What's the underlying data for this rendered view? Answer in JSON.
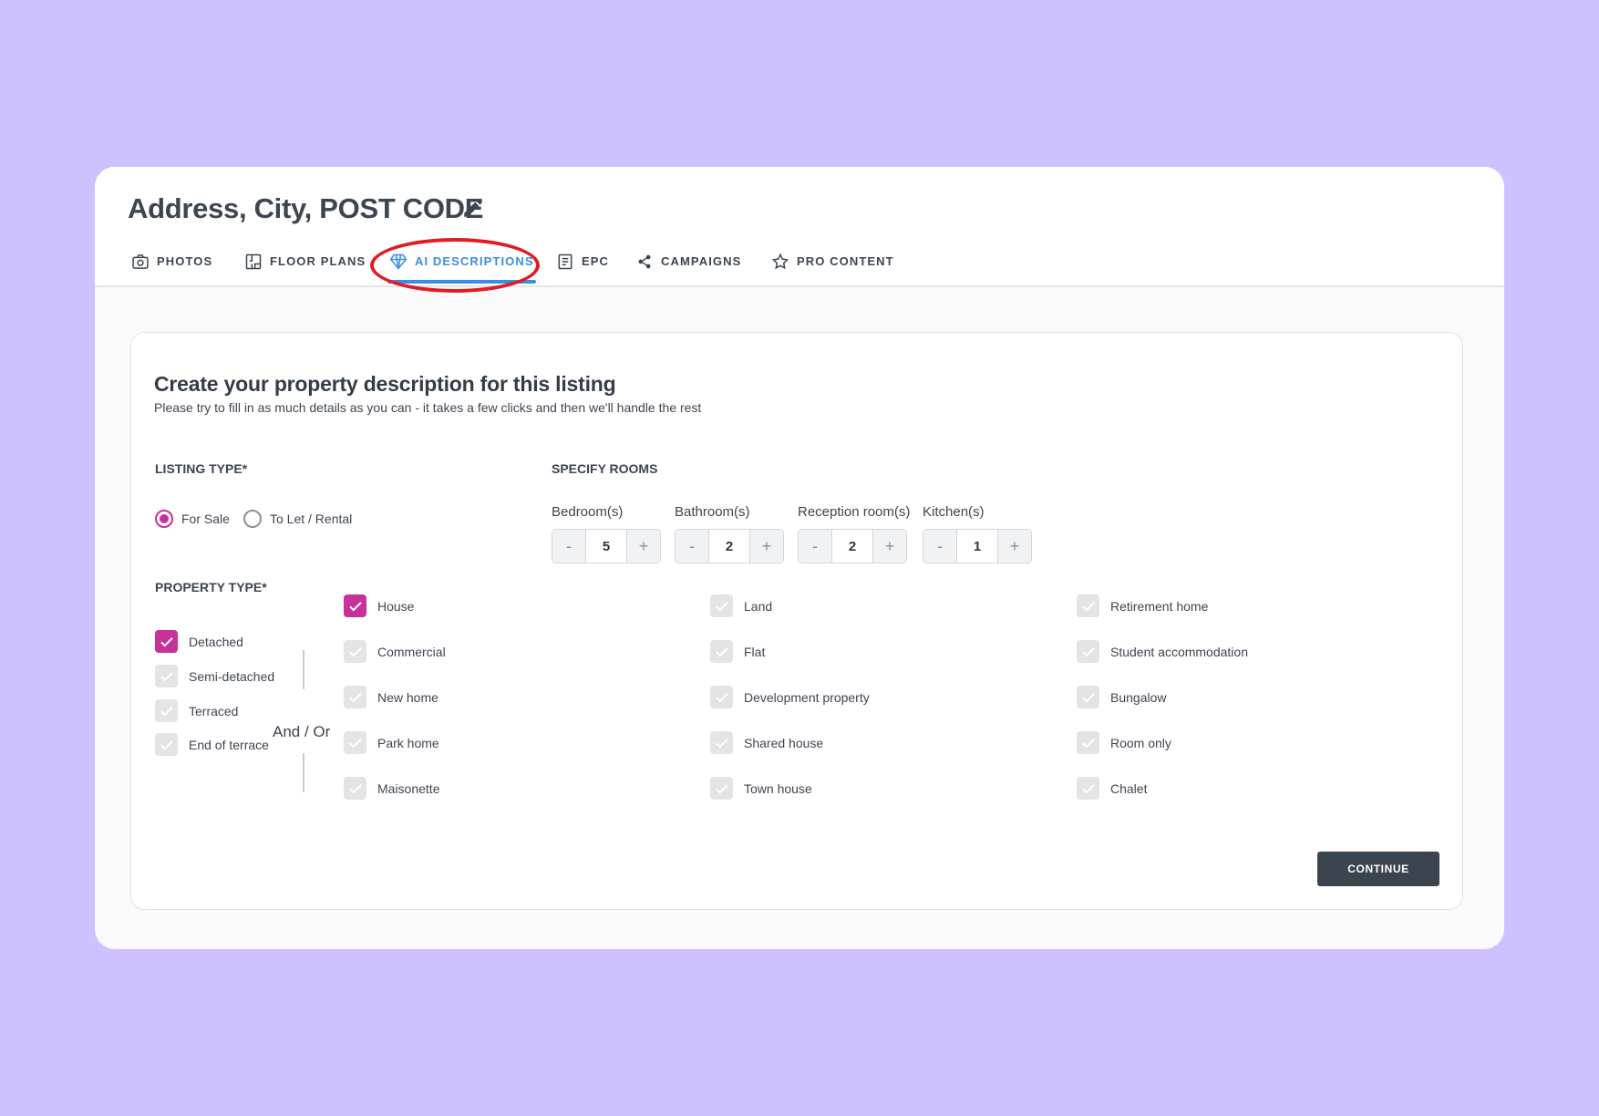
{
  "header": {
    "title": "Address, City, POST CODE",
    "edit_icon": "pencil-icon",
    "tabs": [
      {
        "label": "PHOTOS",
        "icon": "camera-icon"
      },
      {
        "label": "FLOOR PLANS",
        "icon": "floor-plan-icon"
      },
      {
        "label": "AI DESCRIPTIONS",
        "icon": "diamond-icon",
        "active": true
      },
      {
        "label": "EPC",
        "icon": "document-icon"
      },
      {
        "label": "CAMPAIGNS",
        "icon": "share-icon"
      },
      {
        "label": "PRO CONTENT",
        "icon": "star-icon"
      }
    ]
  },
  "form": {
    "title": "Create your property description for this listing",
    "subtitle": "Please try to fill in as much details as you can - it takes a few clicks and then we'll handle the rest",
    "listing_type": {
      "label": "LISTING TYPE*",
      "options": [
        {
          "label": "For Sale",
          "selected": true
        },
        {
          "label": "To Let / Rental",
          "selected": false
        }
      ]
    },
    "rooms": {
      "label": "SPECIFY ROOMS",
      "minus": "-",
      "plus": "+",
      "items": [
        {
          "label": "Bedroom(s)",
          "value": "5"
        },
        {
          "label": "Bathroom(s)",
          "value": "2"
        },
        {
          "label": "Reception room(s)",
          "value": "2"
        },
        {
          "label": "Kitchen(s)",
          "value": "1"
        }
      ]
    },
    "property_type": {
      "label": "PROPERTY TYPE*",
      "styles": [
        {
          "label": "Detached",
          "checked": true
        },
        {
          "label": "Semi-detached",
          "checked": false
        },
        {
          "label": "Terraced",
          "checked": false
        },
        {
          "label": "End of terrace",
          "checked": false
        }
      ],
      "and_or": "And / Or",
      "types": [
        {
          "label": "House",
          "checked": true
        },
        {
          "label": "Commercial",
          "checked": false
        },
        {
          "label": "New home",
          "checked": false
        },
        {
          "label": "Park home",
          "checked": false
        },
        {
          "label": "Maisonette",
          "checked": false
        },
        {
          "label": "Land",
          "checked": false
        },
        {
          "label": "Flat",
          "checked": false
        },
        {
          "label": "Development property",
          "checked": false
        },
        {
          "label": "Shared house",
          "checked": false
        },
        {
          "label": "Town house",
          "checked": false
        },
        {
          "label": "Retirement home",
          "checked": false
        },
        {
          "label": "Student accommodation",
          "checked": false
        },
        {
          "label": "Bungalow",
          "checked": false
        },
        {
          "label": "Room only",
          "checked": false
        },
        {
          "label": "Chalet",
          "checked": false
        }
      ]
    },
    "continue_label": "CONTINUE"
  },
  "colors": {
    "background": "#cfc0ff",
    "accent_tab": "#3a8de0",
    "checkbox_checked": "#c8309a",
    "annotation": "#e01b24",
    "button": "#3b4550"
  }
}
